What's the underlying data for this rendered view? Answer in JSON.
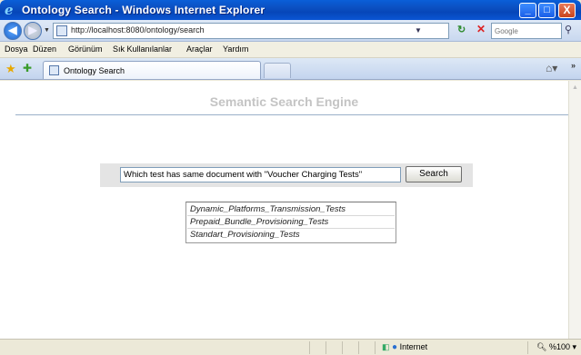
{
  "window": {
    "title": "Ontology Search - Windows Internet Explorer",
    "minimize": "_",
    "maximize": "□",
    "close": "X"
  },
  "address_bar": {
    "url": "http://localhost:8080/ontology/search",
    "search_placeholder": "Google"
  },
  "menu": {
    "items": [
      "Dosya",
      "Düzen",
      "Görünüm",
      "Sık Kullanılanlar",
      "Araçlar",
      "Yardım"
    ]
  },
  "tabs": [
    {
      "label": "Ontology Search"
    }
  ],
  "page": {
    "title": "Semantic Search Engine",
    "query_value": "Which test has same document with \"Voucher Charging Tests\"",
    "search_button": "Search",
    "results": [
      "Dynamic_Platforms_Transmission_Tests",
      "Prepaid_Bundle_Provisioning_Tests",
      "Standart_Provisioning_Tests"
    ]
  },
  "status_bar": {
    "zone": "Internet",
    "zoom": "%100"
  },
  "colors": {
    "titlebar": "#0b4fc1",
    "page_title": "#c4c4c4",
    "panel": "#e4e4e4"
  }
}
